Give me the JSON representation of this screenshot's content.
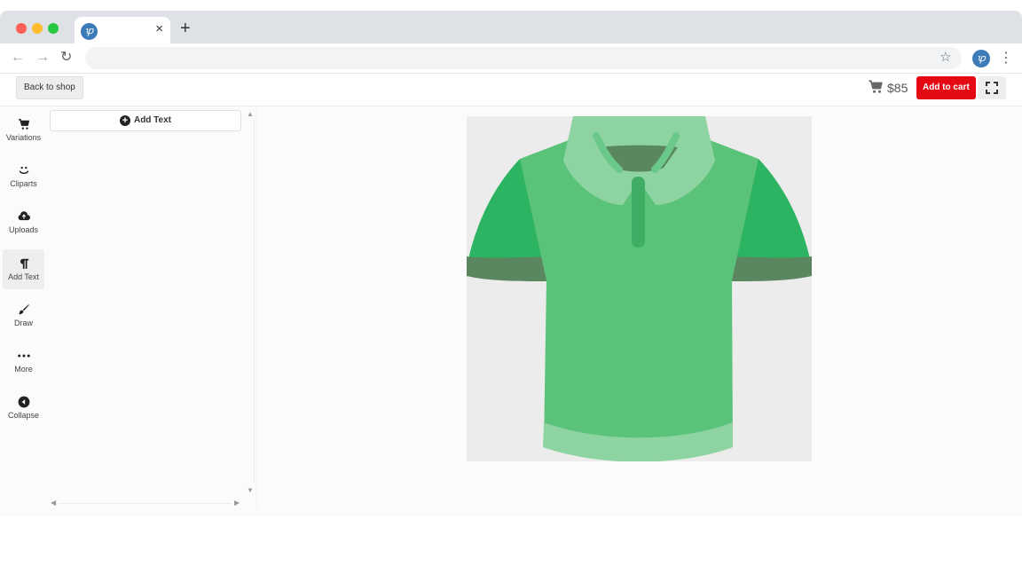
{
  "browser": {
    "tab_favicon_glyph": "ꝕ",
    "tab_close": "×",
    "new_tab": "+",
    "nav_back": "←",
    "nav_forward": "→",
    "nav_reload": "↻",
    "address_value": "",
    "bookmark_star": "☆",
    "profile_glyph": "ꝕ",
    "menu_glyph": "⋮"
  },
  "header": {
    "back_label": "Back to shop",
    "price": "$85",
    "add_to_cart_label": "Add to cart"
  },
  "sidebar": {
    "items": [
      {
        "label": "Variations",
        "icon": "cart-icon"
      },
      {
        "label": "Cliparts",
        "icon": "smile-icon"
      },
      {
        "label": "Uploads",
        "icon": "cloud-upload-icon"
      },
      {
        "label": "Add Text",
        "icon": "paragraph-icon",
        "active": true
      },
      {
        "label": "Draw",
        "icon": "brush-icon"
      },
      {
        "label": "More",
        "icon": "ellipsis-icon"
      },
      {
        "label": "Collapse",
        "icon": "collapse-icon"
      }
    ]
  },
  "panel": {
    "add_text_label": "Add Text",
    "scroll_up": "▲",
    "scroll_down": "▼",
    "scroll_left": "◀",
    "scroll_right": "▶"
  },
  "product": {
    "shirt_main_color": "#5bc27a",
    "sleeve_color": "#2cb462",
    "cuff_color": "#5a8660",
    "collar_color": "#8ed3a2",
    "placket_color": "#3fae64",
    "neck_inner_color": "#5a8660"
  },
  "colors": {
    "accent_red": "#e50914",
    "favicon_blue": "#3d7ab8"
  }
}
